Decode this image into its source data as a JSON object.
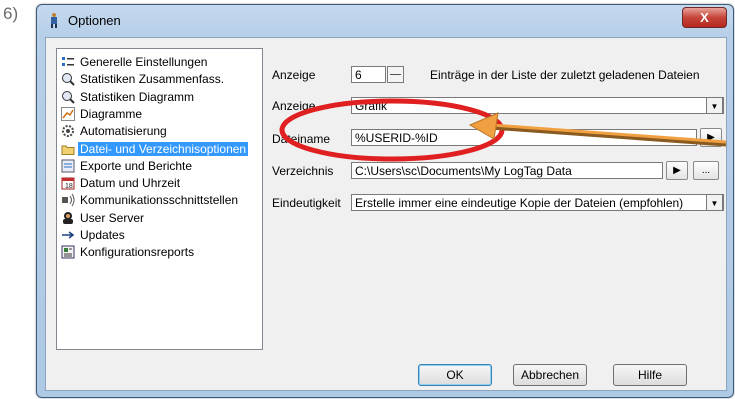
{
  "step_number": "6)",
  "window": {
    "title": "Optionen",
    "close_label": "X"
  },
  "tree": {
    "items": [
      {
        "label": "Generelle Einstellungen",
        "icon": "settings-list-icon"
      },
      {
        "label": "Statistiken Zusammenfass.",
        "icon": "magnifier-icon"
      },
      {
        "label": "Statistiken Diagramm",
        "icon": "magnifier-icon"
      },
      {
        "label": "Diagramme",
        "icon": "line-chart-icon"
      },
      {
        "label": "Automatisierung",
        "icon": "gear-icon"
      },
      {
        "label": "Datei- und Verzeichnisoptionen",
        "icon": "folder-icon",
        "selected": true
      },
      {
        "label": "Exporte und Berichte",
        "icon": "export-icon"
      },
      {
        "label": "Datum und Uhrzeit",
        "icon": "calendar-icon"
      },
      {
        "label": "Kommunikationsschnittstellen",
        "icon": "network-icon"
      },
      {
        "label": "User Server",
        "icon": "user-server-icon"
      },
      {
        "label": "Updates",
        "icon": "arrow-right-icon"
      },
      {
        "label": "Konfigurationsreports",
        "icon": "report-icon"
      }
    ]
  },
  "settings": {
    "anzeige1_label": "Anzeige",
    "anzeige1_value": "6",
    "anzeige1_hint": "Einträge in der Liste der zuletzt geladenen Dateien",
    "anzeige2_label": "Anzeige",
    "anzeige2_value": "Grafik",
    "dateiname_label": "Dateiname",
    "dateiname_value": "%USERID-%ID",
    "verzeichnis_label": "Verzeichnis",
    "verzeichnis_value": "C:\\Users\\sc\\Documents\\My LogTag Data",
    "browse_label": "...",
    "eindeutigkeit_label": "Eindeutigkeit",
    "eindeutigkeit_value": "Erstelle immer eine eindeutige Kopie der Dateien (empfohlen)"
  },
  "buttons": {
    "ok": "OK",
    "cancel": "Abbrechen",
    "help": "Hilfe"
  },
  "annotation": {
    "circle_color": "#e02020",
    "arrow_color": "#f0a040"
  }
}
